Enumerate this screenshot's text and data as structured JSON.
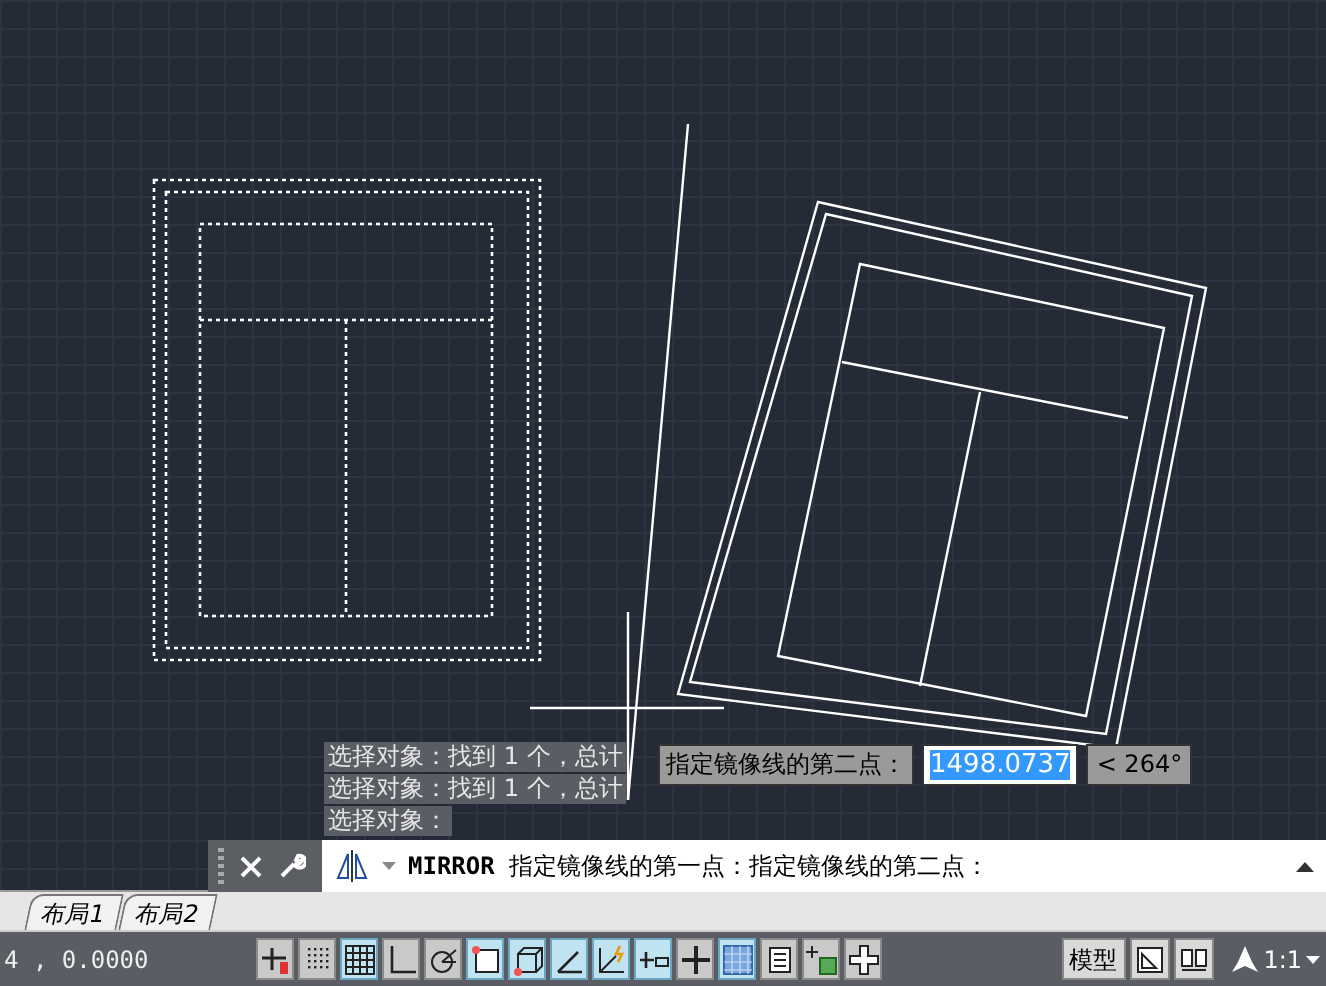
{
  "command_history": [
    {
      "text": "选择对象：找到 1 个，总计"
    },
    {
      "text": "选择对象：找到 1 个，总计"
    },
    {
      "text": "选择对象："
    }
  ],
  "dynamic_input": {
    "prompt": "指定镜像线的第二点：",
    "value": "1498.0737",
    "selected": true,
    "angle": "< 264°"
  },
  "command_line": {
    "text": "**MIRROR** 指定镜像线的第一点：指定镜像线的第二点："
  },
  "layout_tabs": [
    {
      "label": "布局1",
      "selected": false
    },
    {
      "label": "布局2",
      "selected": false
    }
  ],
  "coordinates": "4 , 0.0000",
  "status_toggles": [
    {
      "kind": "infer",
      "on": false
    },
    {
      "kind": "snap",
      "on": false
    },
    {
      "kind": "grid",
      "on": true
    },
    {
      "kind": "ortho",
      "on": false
    },
    {
      "kind": "polar",
      "on": false
    },
    {
      "kind": "osnap",
      "on": true
    },
    {
      "kind": "osnap3d",
      "on": true
    },
    {
      "kind": "otrack",
      "on": true
    },
    {
      "kind": "ducs",
      "on": true
    },
    {
      "kind": "dyn",
      "on": true
    },
    {
      "kind": "lineweight",
      "on": false
    },
    {
      "kind": "transparency",
      "on": true
    },
    {
      "kind": "properties",
      "on": false
    },
    {
      "kind": "cycling",
      "on": false
    },
    {
      "kind": "monitor",
      "on": false
    }
  ],
  "model_button": "模型",
  "annotation_scale": "1:1"
}
